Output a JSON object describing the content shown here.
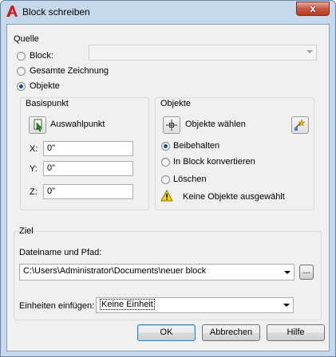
{
  "window": {
    "title": "Block schreiben",
    "close_glyph": "x"
  },
  "source": {
    "group_label": "Quelle",
    "options": [
      {
        "label": "Block:",
        "selected": false
      },
      {
        "label": "Gesamte Zeichnung",
        "selected": false
      },
      {
        "label": "Objekte",
        "selected": true
      }
    ],
    "block_select": {
      "value": "",
      "enabled": false
    }
  },
  "base_point": {
    "group_label": "Basispunkt",
    "pick_label": "Auswahlpunkt",
    "fields": [
      {
        "label": "X:",
        "value": "0\""
      },
      {
        "label": "Y:",
        "value": "0\""
      },
      {
        "label": "Z:",
        "value": "0\""
      }
    ]
  },
  "objects": {
    "group_label": "Objekte",
    "select_label": "Objekte wählen",
    "options": [
      {
        "label": "Beibehalten",
        "selected": true
      },
      {
        "label": "In Block konvertieren",
        "selected": false
      },
      {
        "label": "Löschen",
        "selected": false
      }
    ],
    "warning": "Keine Objekte ausgewählt"
  },
  "target": {
    "group_label": "Ziel",
    "path_label": "Dateiname und Pfad:",
    "path_value": "C:\\Users\\Administrator\\Documents\\neuer block",
    "browse_label": "...",
    "units_label": "Einheiten einfügen:",
    "units_value": "Keine Einheit"
  },
  "buttons": {
    "ok": "OK",
    "cancel": "Abbrechen",
    "help": "Hilfe"
  },
  "colors": {
    "accent": "#1a4f9a",
    "window_frame": "#c6d8ec",
    "close": "#c75a44",
    "warning": "#f5d20a"
  }
}
